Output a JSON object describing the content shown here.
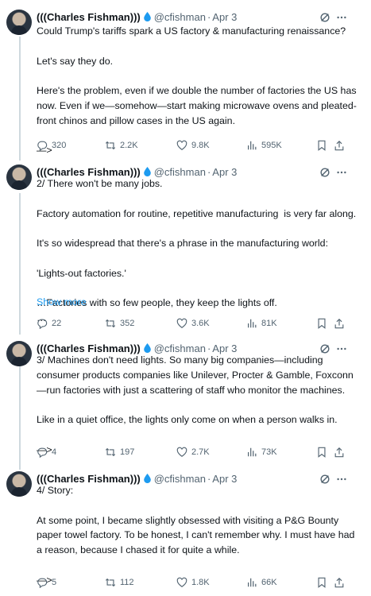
{
  "colors": {
    "accent": "#1d9bf0",
    "muted": "#536471",
    "text": "#0f1419",
    "divider": "#eff3f4"
  },
  "tweets": [
    {
      "name": "(((Charles Fishman)))",
      "handle": "@cfishman",
      "date": "Apr 3",
      "paragraphs": [
        "Could Trump's tariffs spark a US factory & manufacturing renaissance?",
        "Let's say they do.",
        "Here's the problem, even if we double the number of factories the US has now. Even if we—somehow—start making microwave ovens and pleated-front chinos and pillow cases in the US again.",
        "—>"
      ],
      "show_more": "",
      "replies": "320",
      "reposts": "2.2K",
      "likes": "9.8K",
      "views": "595K"
    },
    {
      "name": "(((Charles Fishman)))",
      "handle": "@cfishman",
      "date": "Apr 3",
      "paragraphs": [
        "2/ There won't be many jobs.",
        "Factory automation for routine, repetitive manufacturing  is very far along.",
        "It's so widespread that there's a phrase in the manufacturing world:",
        "'Lights-out factories.'",
        "…Factories with so few people, they keep the lights off.\n…"
      ],
      "show_more": "Show more",
      "replies": "22",
      "reposts": "352",
      "likes": "3.6K",
      "views": "81K"
    },
    {
      "name": "(((Charles Fishman)))",
      "handle": "@cfishman",
      "date": "Apr 3",
      "paragraphs": [
        "3/ Machines don't need lights. So many big companies—including consumer products companies like Unilever, Procter & Gamble, Foxconn—run factories with just a scattering of staff who monitor the machines.",
        "Like in a quiet office, the lights only come on when a person walks in.",
        "—>"
      ],
      "show_more": "",
      "replies": "4",
      "reposts": "197",
      "likes": "2.7K",
      "views": "73K"
    },
    {
      "name": "(((Charles Fishman)))",
      "handle": "@cfishman",
      "date": "Apr 3",
      "paragraphs": [
        "4/ Story:",
        "At some point, I became slightly obsessed with visiting a P&G Bounty paper towel factory. To be honest, I can't remember why. I must have had a reason, because I chased it for quite a while.",
        "—>"
      ],
      "show_more": "",
      "replies": "5",
      "reposts": "112",
      "likes": "1.8K",
      "views": "66K"
    }
  ],
  "icons": {
    "verified": "water-drop-icon",
    "grok": "grok-icon",
    "more": "more-dots-icon",
    "reply": "reply-icon",
    "repost": "repost-icon",
    "like": "heart-icon",
    "views": "views-chart-icon",
    "bookmark": "bookmark-icon",
    "share": "share-icon"
  }
}
